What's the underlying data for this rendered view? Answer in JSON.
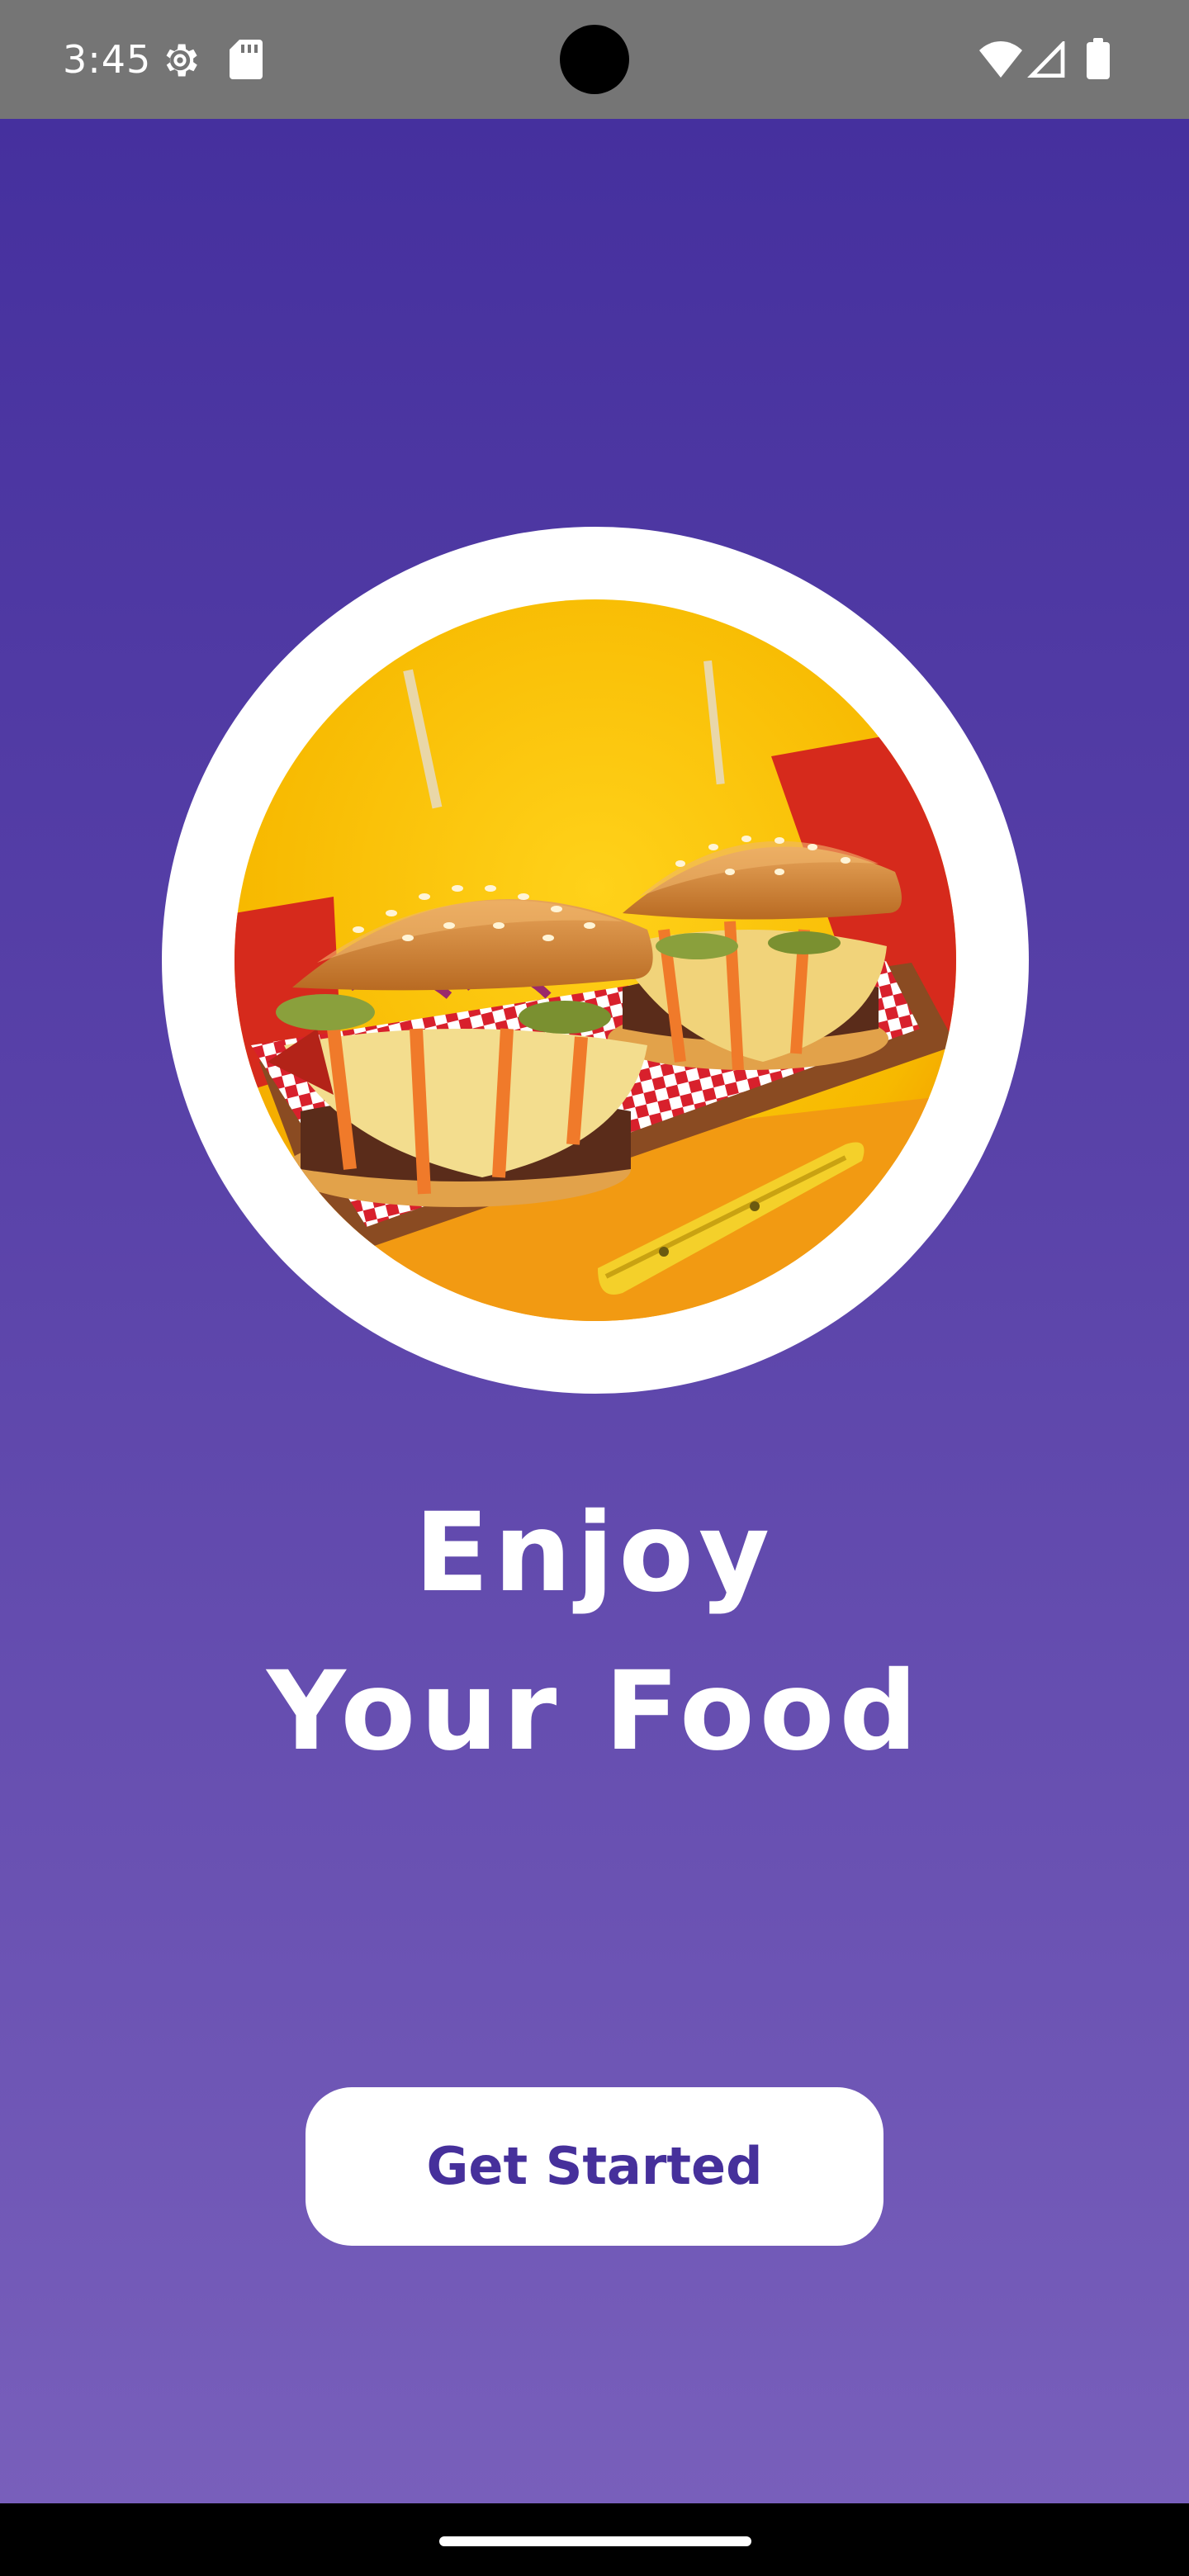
{
  "status_bar": {
    "time": "3:45",
    "icons": [
      "settings-icon",
      "sdcard-icon",
      "wifi-icon",
      "signal-icon",
      "battery-icon"
    ]
  },
  "hero": {
    "image": "burgers-photo",
    "ring_color": "#ffffff"
  },
  "headline": {
    "line1": "Enjoy",
    "line2": "Your Food"
  },
  "cta": {
    "label": "Get Started"
  },
  "colors": {
    "gradient_top": "#45309e",
    "gradient_bottom": "#785fbb",
    "accent_text": "#46309b",
    "status_bar": "#757575"
  }
}
